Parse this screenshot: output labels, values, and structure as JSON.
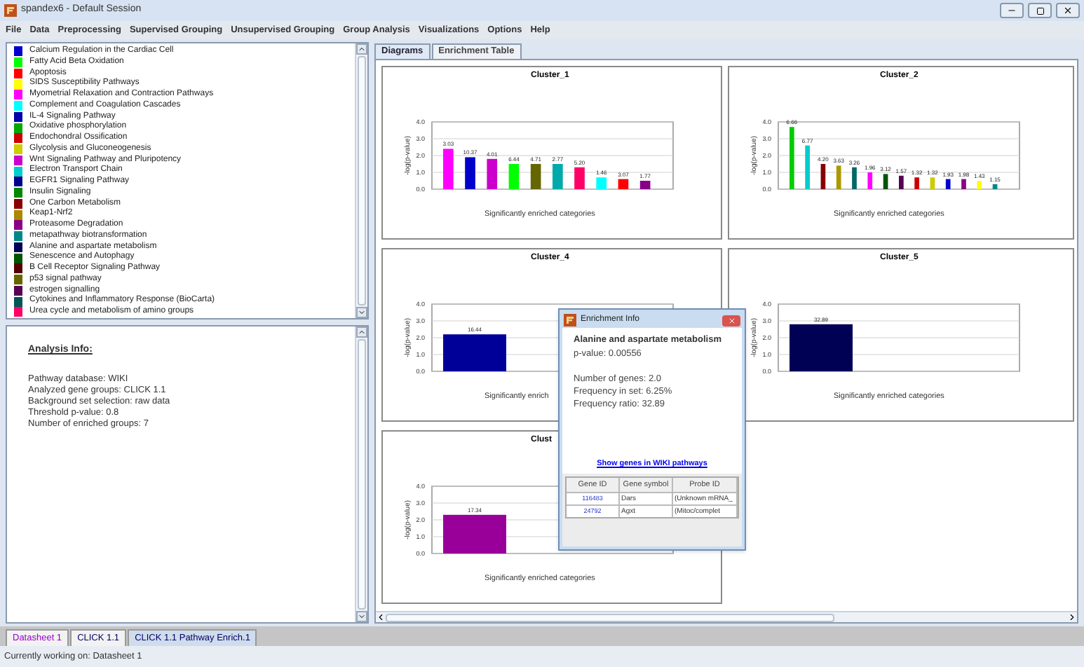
{
  "window": {
    "title": "spandex6 - Default Session"
  },
  "menu": [
    "File",
    "Data",
    "Preprocessing",
    "Supervised Grouping",
    "Unsupervised Grouping",
    "Group Analysis",
    "Visualizations",
    "Options",
    "Help"
  ],
  "legend": {
    "items": [
      {
        "label": "Calcium Regulation in the Cardiac Cell",
        "color": "#0000cc"
      },
      {
        "label": "Fatty Acid Beta Oxidation",
        "color": "#00ff00"
      },
      {
        "label": "Apoptosis",
        "color": "#ff0000"
      },
      {
        "label": "SIDS Susceptibility Pathways",
        "color": "#ffff00"
      },
      {
        "label": "Myometrial Relaxation and Contraction Pathways",
        "color": "#ff00ff"
      },
      {
        "label": "Complement and Coagulation Cascades",
        "color": "#00ffff"
      },
      {
        "label": "IL-4 Signaling Pathway",
        "color": "#0000aa"
      },
      {
        "label": "Oxidative phosphorylation",
        "color": "#00aa00"
      },
      {
        "label": "Endochondral Ossification",
        "color": "#cc0000"
      },
      {
        "label": "Glycolysis and Gluconeogenesis",
        "color": "#cccc00"
      },
      {
        "label": "Wnt Signaling Pathway and Pluripotency",
        "color": "#cc00cc"
      },
      {
        "label": "Electron Transport Chain",
        "color": "#00cccc"
      },
      {
        "label": "EGFR1 Signaling Pathway",
        "color": "#000088"
      },
      {
        "label": "Insulin Signaling",
        "color": "#008800"
      },
      {
        "label": "One Carbon Metabolism",
        "color": "#880000"
      },
      {
        "label": "Keap1-Nrf2",
        "color": "#aa8800"
      },
      {
        "label": "Proteasome Degradation",
        "color": "#880088"
      },
      {
        "label": "metapathway biotransformation",
        "color": "#008888"
      },
      {
        "label": "Alanine and aspartate metabolism",
        "color": "#000055"
      },
      {
        "label": "Senescence and Autophagy",
        "color": "#005500"
      },
      {
        "label": "B Cell Receptor Signaling Pathway",
        "color": "#550000"
      },
      {
        "label": "p53 signal pathway",
        "color": "#666600"
      },
      {
        "label": "estrogen signalling",
        "color": "#550055"
      },
      {
        "label": "Cytokines and Inflammatory Response (BioCarta)",
        "color": "#005555"
      },
      {
        "label": "Urea cycle and metabolism of amino groups",
        "color": "#ff0066"
      }
    ]
  },
  "analysis_info": {
    "heading": "Analysis Info:",
    "lines": [
      "Pathway database: WIKI",
      "Analyzed gene groups: CLICK 1.1",
      "Background set selection: raw data",
      "Threshold p-value: 0.8",
      "Number of enriched groups: 7"
    ]
  },
  "view_tabs": [
    {
      "label": "Diagrams",
      "selected": true
    },
    {
      "label": "Enrichment Table",
      "selected": false
    }
  ],
  "charts": [
    {
      "chart_data": {
        "type": "bar",
        "title": "Cluster_1",
        "xlabel": "Significantly enriched categories",
        "ylabel": "-log(p-value)",
        "ylim": [
          0,
          4
        ],
        "yticks": [
          {
            "value": 0,
            "label": "0.0"
          },
          {
            "value": 1,
            "label": "1.0"
          },
          {
            "value": 2,
            "label": "2.0"
          },
          {
            "value": 3,
            "label": "3.0"
          },
          {
            "value": 4,
            "label": "4.0"
          }
        ],
        "grid": true,
        "series": [
          {
            "colors": [
              "#ff00ff",
              "#0000cc",
              "#cc00cc",
              "#00ff00",
              "#666600",
              "#00aaaa",
              "#ff0066",
              "#00ffff",
              "#ff0000",
              "#880088"
            ],
            "values": [
              2.4,
              1.9,
              1.8,
              1.5,
              1.5,
              1.5,
              1.3,
              0.7,
              0.6,
              0.5
            ]
          }
        ],
        "value_labels": [
          "3.03",
          "10.37",
          "4.01",
          "6.44",
          "4.71",
          "2.77",
          "5.20",
          "1.46",
          "3.07",
          "1.77"
        ]
      }
    },
    {
      "chart_data": {
        "type": "bar",
        "title": "Cluster_2",
        "xlabel": "Significantly enriched categories",
        "ylabel": "-log(p-value)",
        "ylim": [
          0,
          4
        ],
        "yticks": [
          {
            "value": 0,
            "label": "0.0"
          },
          {
            "value": 1,
            "label": "1.0"
          },
          {
            "value": 2,
            "label": "2.0"
          },
          {
            "value": 3,
            "label": "3.0"
          },
          {
            "value": 4,
            "label": "4.0"
          }
        ],
        "grid": true,
        "series": [
          {
            "colors": [
              "#00cc00",
              "#00cccc",
              "#880000",
              "#aa9900",
              "#006666",
              "#ff00ff",
              "#005500",
              "#550055",
              "#cc0000",
              "#cccc00",
              "#0000cc",
              "#880088",
              "#ffff00",
              "#008888"
            ],
            "values": [
              3.7,
              2.6,
              1.5,
              1.4,
              1.3,
              1.0,
              0.9,
              0.8,
              0.7,
              0.7,
              0.6,
              0.6,
              0.5,
              0.3
            ]
          }
        ],
        "value_labels": [
          "6.66",
          "6.77",
          "4.20",
          "3.63",
          "3.26",
          "1.96",
          "3.12",
          "1.57",
          "1.32",
          "1.32",
          "1.93",
          "1.98",
          "1.43",
          "1.15"
        ]
      }
    },
    {
      "chart_data": {
        "type": "bar",
        "title": "Cluster_4",
        "xlabel": "Significantly enrich",
        "ylabel": "-log(p-value)",
        "ylim": [
          0,
          4
        ],
        "yticks": [
          {
            "value": 0,
            "label": "0.0"
          },
          {
            "value": 1,
            "label": "1.0"
          },
          {
            "value": 2,
            "label": "2.0"
          },
          {
            "value": 3,
            "label": "3.0"
          },
          {
            "value": 4,
            "label": "4.0"
          }
        ],
        "grid": true,
        "series": [
          {
            "colors": [
              "#000099"
            ],
            "values": [
              2.2
            ]
          }
        ],
        "value_labels": [
          "16.44"
        ]
      }
    },
    {
      "chart_data": {
        "type": "bar",
        "title": "Cluster_5",
        "xlabel": "Significantly enriched categories",
        "ylabel": "-log(p-value)",
        "ylim": [
          0,
          4
        ],
        "yticks": [
          {
            "value": 0,
            "label": "0.0"
          },
          {
            "value": 1,
            "label": "1.0"
          },
          {
            "value": 2,
            "label": "2.0"
          },
          {
            "value": 3,
            "label": "3.0"
          },
          {
            "value": 4,
            "label": "4.0"
          }
        ],
        "grid": true,
        "series": [
          {
            "colors": [
              "#000055"
            ],
            "values": [
              2.8
            ]
          }
        ],
        "value_labels": [
          "32.89"
        ]
      }
    },
    {
      "chart_data": {
        "type": "bar",
        "title": "Clust",
        "xlabel": "Significantly enriched categories",
        "ylabel": "-log(p-value)",
        "ylim": [
          0,
          4
        ],
        "yticks": [
          {
            "value": 0,
            "label": "0.0"
          },
          {
            "value": 1,
            "label": "1.0"
          },
          {
            "value": 2,
            "label": "2.0"
          },
          {
            "value": 3,
            "label": "3.0"
          },
          {
            "value": 4,
            "label": "4.0"
          }
        ],
        "grid": true,
        "series": [
          {
            "colors": [
              "#990099"
            ],
            "values": [
              2.3
            ]
          }
        ],
        "value_labels": [
          "17.34"
        ]
      }
    }
  ],
  "dialog": {
    "title": "Enrichment Info",
    "heading": "Alanine and aspartate metabolism",
    "p_value": "p-value: 0.00556",
    "details": [
      "Number of genes: 2.0",
      "Frequency in set: 6.25%",
      "Frequency ratio: 32.89"
    ],
    "link": "Show genes in WIKI pathways",
    "table": {
      "columns": [
        "Gene ID",
        "Gene symbol",
        "Probe ID"
      ],
      "rows": [
        [
          "116483",
          "Dars",
          "(Unknown mRNA_"
        ],
        [
          "24792",
          "Agxt",
          "(Mitoc/complet"
        ]
      ]
    }
  },
  "sheet_tabs": [
    {
      "label": "Datasheet 1",
      "selected": false,
      "color": "#9900cc"
    },
    {
      "label": "CLICK 1.1",
      "selected": false,
      "color": "#000066"
    },
    {
      "label": "CLICK 1.1 Pathway Enrich.1",
      "selected": true,
      "color": "#000066"
    }
  ],
  "status_bar": "Currently working on: Datasheet 1"
}
